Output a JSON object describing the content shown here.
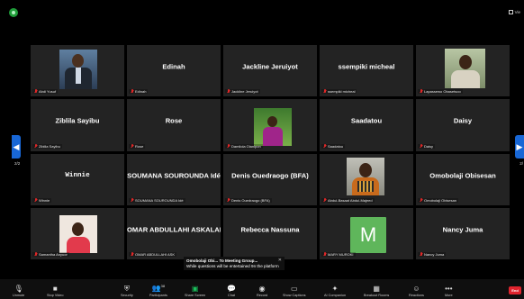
{
  "window": {
    "view_label": "Vie"
  },
  "tiles": [
    {
      "big": "",
      "label": "Abdi Yusuf"
    },
    {
      "big": "Edinah",
      "label": "Edinah"
    },
    {
      "big": "Jackline Jeruiyot",
      "label": "Jackline Jeruiyot"
    },
    {
      "big": "ssempiki micheal",
      "label": "ssempiki micheal"
    },
    {
      "big": "",
      "label": "Lapassewo Obasetsoo"
    },
    {
      "big": "Ziblila Sayibu",
      "label": "Ziblila Sayibu"
    },
    {
      "big": "Rose",
      "label": "Rose"
    },
    {
      "big": "",
      "label": "Damilola Olanipon"
    },
    {
      "big": "Saadatou",
      "label": "Saadatou"
    },
    {
      "big": "Daisy",
      "label": "Daisy"
    },
    {
      "big": "Winnie",
      "label": "Winnie"
    },
    {
      "big": "SOUMANA SOUROUNDA Idé",
      "label": "SOUMANA SOUROUNDA Idé"
    },
    {
      "big": "Denis Ouedraogo (BFA)",
      "label": "Denis Ouedraogo (BFA)"
    },
    {
      "big": "",
      "label": "Abdul-Basaat Abdul-Majeed"
    },
    {
      "big": "Omobolaji Obisesan",
      "label": "Omobolaji Obisesan"
    },
    {
      "big": "",
      "label": "Samantha Anyuor"
    },
    {
      "big": "OMAR ABDULLAHI ASKALAN",
      "label": "OMAR ABDULLAHI ASK"
    },
    {
      "big": "Rebecca Nassuna",
      "label": ""
    },
    {
      "big": "",
      "label": "MARY MUROKI",
      "initial": "M"
    },
    {
      "big": "Nancy Juma",
      "label": "Nancy Juma"
    }
  ],
  "pagination": {
    "left": "2/2",
    "right": "2/"
  },
  "chat_popup": {
    "from": "Omobolaji Obi... To Meeting Group...",
    "body": "While questions will be entertained 9n the platform"
  },
  "toolbar": {
    "items": [
      {
        "label": "Unmute",
        "icon": "mic-icon"
      },
      {
        "label": "Stop Video",
        "icon": "video-icon"
      },
      {
        "label": "Security",
        "icon": "shield-icon"
      },
      {
        "label": "Participants",
        "icon": "people-icon",
        "count": "38"
      },
      {
        "label": "Share Screen",
        "icon": "share-icon"
      },
      {
        "label": "Chat",
        "icon": "chat-icon"
      },
      {
        "label": "Record",
        "icon": "record-icon"
      },
      {
        "label": "Show Captions",
        "icon": "cc-icon"
      },
      {
        "label": "AI Companion",
        "icon": "sparkle-icon"
      },
      {
        "label": "Breakout Rooms",
        "icon": "grid-icon"
      },
      {
        "label": "Reactions",
        "icon": "smile-icon"
      },
      {
        "label": "More",
        "icon": "more-icon"
      }
    ],
    "end_label": "End"
  },
  "colors": {
    "tile_bg": "#232323",
    "accent": "#1867d6",
    "share_green": "#1bbf5c",
    "end_red": "#e0242e"
  }
}
